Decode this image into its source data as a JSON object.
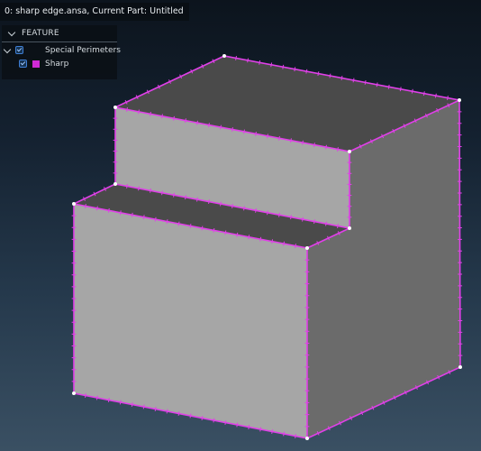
{
  "window": {
    "title": "0: sharp edge.ansa,  Current Part: Untitled"
  },
  "feature_panel": {
    "header": "FEATURE",
    "groups": [
      {
        "label": "Special Perimeters",
        "expanded": true,
        "checked": true,
        "items": [
          {
            "label": "Sharp",
            "checked": true,
            "color": "#d02ad6"
          }
        ]
      }
    ]
  },
  "viewport": {
    "background_top": "#0c141d",
    "background_bottom": "#3a5063",
    "perimeter_color": "#e040e8",
    "vertex_color": "#ffffff",
    "face_colors": {
      "top": "#4a4a4a",
      "front": "#a6a6a6",
      "side": "#6b6b6b"
    }
  }
}
